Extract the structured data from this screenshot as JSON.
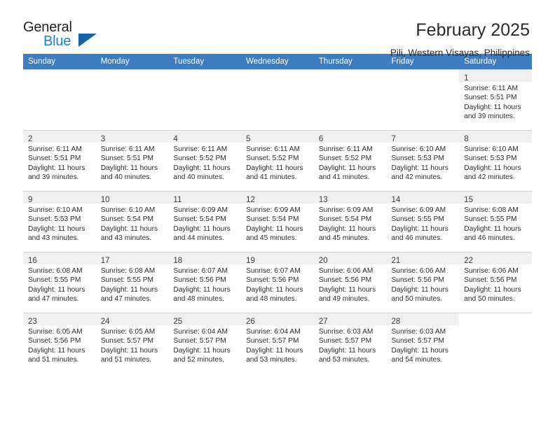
{
  "brand": {
    "name_part1": "General",
    "name_part2": "Blue",
    "triangle_color": "#1463a8",
    "blue_color": "#1b7fd4",
    "dark_color": "#231f20"
  },
  "header": {
    "title": "February 2025",
    "subtitle": "Pili, Western Visayas, Philippines"
  },
  "theme": {
    "header_row_bg": "#3c7cbf",
    "header_row_text": "#ffffff",
    "daynum_bg": "#f0f0f0",
    "grid_line": "#c9d3dc"
  },
  "weekdays": [
    "Sunday",
    "Monday",
    "Tuesday",
    "Wednesday",
    "Thursday",
    "Friday",
    "Saturday"
  ],
  "labels": {
    "sunrise_prefix": "Sunrise:",
    "sunset_prefix": "Sunset:",
    "daylight_prefix": "Daylight:"
  },
  "weeks": [
    [
      {
        "empty": true
      },
      {
        "empty": true
      },
      {
        "empty": true
      },
      {
        "empty": true
      },
      {
        "empty": true
      },
      {
        "empty": true
      },
      {
        "empty": false,
        "day": "1",
        "sunrise": "Sunrise: 6:11 AM",
        "sunset": "Sunset: 5:51 PM",
        "daylight": "Daylight: 11 hours and 39 minutes."
      }
    ],
    [
      {
        "empty": false,
        "day": "2",
        "sunrise": "Sunrise: 6:11 AM",
        "sunset": "Sunset: 5:51 PM",
        "daylight": "Daylight: 11 hours and 39 minutes."
      },
      {
        "empty": false,
        "day": "3",
        "sunrise": "Sunrise: 6:11 AM",
        "sunset": "Sunset: 5:51 PM",
        "daylight": "Daylight: 11 hours and 40 minutes."
      },
      {
        "empty": false,
        "day": "4",
        "sunrise": "Sunrise: 6:11 AM",
        "sunset": "Sunset: 5:52 PM",
        "daylight": "Daylight: 11 hours and 40 minutes."
      },
      {
        "empty": false,
        "day": "5",
        "sunrise": "Sunrise: 6:11 AM",
        "sunset": "Sunset: 5:52 PM",
        "daylight": "Daylight: 11 hours and 41 minutes."
      },
      {
        "empty": false,
        "day": "6",
        "sunrise": "Sunrise: 6:11 AM",
        "sunset": "Sunset: 5:52 PM",
        "daylight": "Daylight: 11 hours and 41 minutes."
      },
      {
        "empty": false,
        "day": "7",
        "sunrise": "Sunrise: 6:10 AM",
        "sunset": "Sunset: 5:53 PM",
        "daylight": "Daylight: 11 hours and 42 minutes."
      },
      {
        "empty": false,
        "day": "8",
        "sunrise": "Sunrise: 6:10 AM",
        "sunset": "Sunset: 5:53 PM",
        "daylight": "Daylight: 11 hours and 42 minutes."
      }
    ],
    [
      {
        "empty": false,
        "day": "9",
        "sunrise": "Sunrise: 6:10 AM",
        "sunset": "Sunset: 5:53 PM",
        "daylight": "Daylight: 11 hours and 43 minutes."
      },
      {
        "empty": false,
        "day": "10",
        "sunrise": "Sunrise: 6:10 AM",
        "sunset": "Sunset: 5:54 PM",
        "daylight": "Daylight: 11 hours and 43 minutes."
      },
      {
        "empty": false,
        "day": "11",
        "sunrise": "Sunrise: 6:09 AM",
        "sunset": "Sunset: 5:54 PM",
        "daylight": "Daylight: 11 hours and 44 minutes."
      },
      {
        "empty": false,
        "day": "12",
        "sunrise": "Sunrise: 6:09 AM",
        "sunset": "Sunset: 5:54 PM",
        "daylight": "Daylight: 11 hours and 45 minutes."
      },
      {
        "empty": false,
        "day": "13",
        "sunrise": "Sunrise: 6:09 AM",
        "sunset": "Sunset: 5:54 PM",
        "daylight": "Daylight: 11 hours and 45 minutes."
      },
      {
        "empty": false,
        "day": "14",
        "sunrise": "Sunrise: 6:09 AM",
        "sunset": "Sunset: 5:55 PM",
        "daylight": "Daylight: 11 hours and 46 minutes."
      },
      {
        "empty": false,
        "day": "15",
        "sunrise": "Sunrise: 6:08 AM",
        "sunset": "Sunset: 5:55 PM",
        "daylight": "Daylight: 11 hours and 46 minutes."
      }
    ],
    [
      {
        "empty": false,
        "day": "16",
        "sunrise": "Sunrise: 6:08 AM",
        "sunset": "Sunset: 5:55 PM",
        "daylight": "Daylight: 11 hours and 47 minutes."
      },
      {
        "empty": false,
        "day": "17",
        "sunrise": "Sunrise: 6:08 AM",
        "sunset": "Sunset: 5:55 PM",
        "daylight": "Daylight: 11 hours and 47 minutes."
      },
      {
        "empty": false,
        "day": "18",
        "sunrise": "Sunrise: 6:07 AM",
        "sunset": "Sunset: 5:56 PM",
        "daylight": "Daylight: 11 hours and 48 minutes."
      },
      {
        "empty": false,
        "day": "19",
        "sunrise": "Sunrise: 6:07 AM",
        "sunset": "Sunset: 5:56 PM",
        "daylight": "Daylight: 11 hours and 48 minutes."
      },
      {
        "empty": false,
        "day": "20",
        "sunrise": "Sunrise: 6:06 AM",
        "sunset": "Sunset: 5:56 PM",
        "daylight": "Daylight: 11 hours and 49 minutes."
      },
      {
        "empty": false,
        "day": "21",
        "sunrise": "Sunrise: 6:06 AM",
        "sunset": "Sunset: 5:56 PM",
        "daylight": "Daylight: 11 hours and 50 minutes."
      },
      {
        "empty": false,
        "day": "22",
        "sunrise": "Sunrise: 6:06 AM",
        "sunset": "Sunset: 5:56 PM",
        "daylight": "Daylight: 11 hours and 50 minutes."
      }
    ],
    [
      {
        "empty": false,
        "day": "23",
        "sunrise": "Sunrise: 6:05 AM",
        "sunset": "Sunset: 5:56 PM",
        "daylight": "Daylight: 11 hours and 51 minutes."
      },
      {
        "empty": false,
        "day": "24",
        "sunrise": "Sunrise: 6:05 AM",
        "sunset": "Sunset: 5:57 PM",
        "daylight": "Daylight: 11 hours and 51 minutes."
      },
      {
        "empty": false,
        "day": "25",
        "sunrise": "Sunrise: 6:04 AM",
        "sunset": "Sunset: 5:57 PM",
        "daylight": "Daylight: 11 hours and 52 minutes."
      },
      {
        "empty": false,
        "day": "26",
        "sunrise": "Sunrise: 6:04 AM",
        "sunset": "Sunset: 5:57 PM",
        "daylight": "Daylight: 11 hours and 53 minutes."
      },
      {
        "empty": false,
        "day": "27",
        "sunrise": "Sunrise: 6:03 AM",
        "sunset": "Sunset: 5:57 PM",
        "daylight": "Daylight: 11 hours and 53 minutes."
      },
      {
        "empty": false,
        "day": "28",
        "sunrise": "Sunrise: 6:03 AM",
        "sunset": "Sunset: 5:57 PM",
        "daylight": "Daylight: 11 hours and 54 minutes."
      },
      {
        "empty": true
      }
    ]
  ]
}
